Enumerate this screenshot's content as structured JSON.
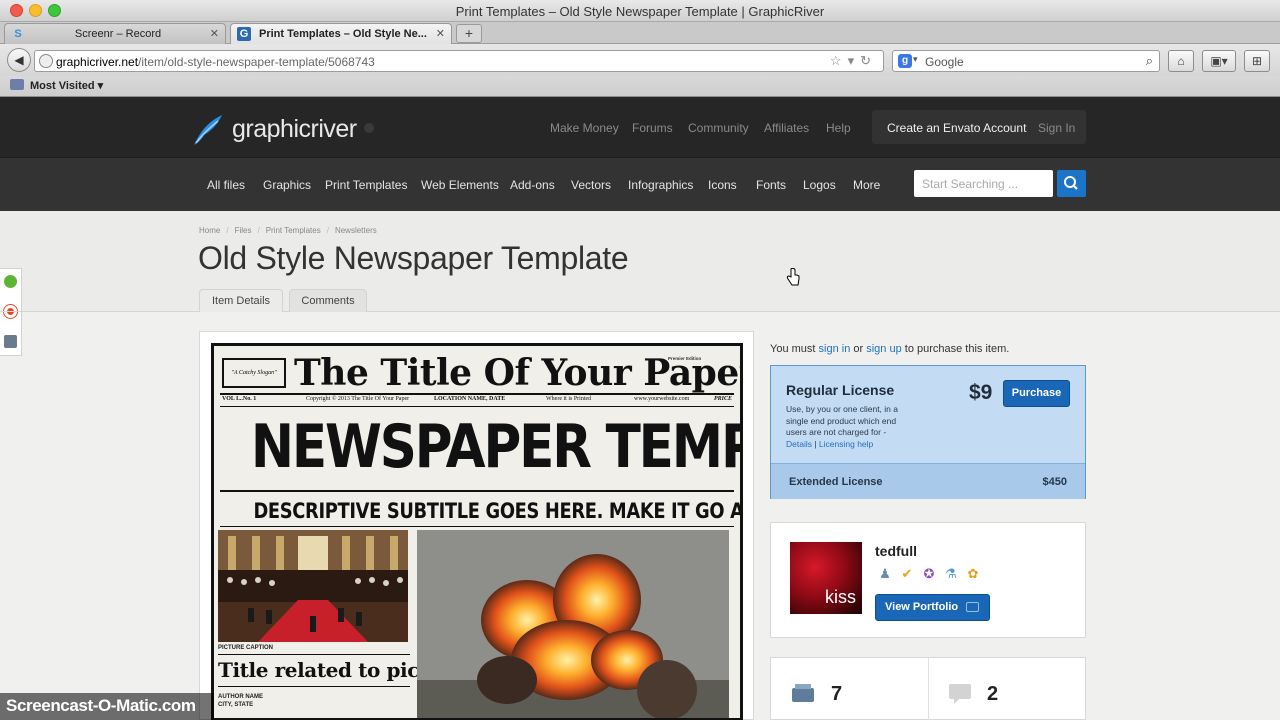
{
  "window": {
    "title": "Print Templates – Old Style Newspaper Template | GraphicRiver"
  },
  "tabs": [
    {
      "label": "Screenr – Record",
      "favicon": "S"
    },
    {
      "label": "Print Templates – Old Style Ne...",
      "favicon": "G"
    }
  ],
  "newtab_label": "+",
  "urlbar": {
    "host": "graphicriver.net",
    "path": "/item/old-style-newspaper-template/5068743"
  },
  "search": {
    "engine": "Google"
  },
  "bookmarks": {
    "most_visited": "Most Visited"
  },
  "header": {
    "logo": "graphicriver",
    "nav": [
      "Make Money",
      "Forums",
      "Community",
      "Affiliates",
      "Help"
    ],
    "create_account": "Create an Envato Account",
    "sign_in": "Sign In"
  },
  "categories": [
    "All files",
    "Graphics",
    "Print Templates",
    "Web Elements",
    "Add-ons",
    "Vectors",
    "Infographics",
    "Icons",
    "Fonts",
    "Logos",
    "More"
  ],
  "site_search": {
    "placeholder": "Start Searching ..."
  },
  "breadcrumb": [
    "Home",
    "Files",
    "Print Templates",
    "Newsletters"
  ],
  "page_title": "Old Style Newspaper Template",
  "page_tabs": [
    "Item Details",
    "Comments"
  ],
  "preview": {
    "slogan": "\"A Catchy Slogan\"",
    "masthead": "The Title Of Your Paper",
    "edition": "Premier Edition",
    "vol": "VOL I...No. 1",
    "copyright": "Copyright © 2013 The Title Of Your Paper",
    "location": "LOCATION NAME, DATE",
    "where": "Where it is Printed",
    "website": "www.yourwebsite.com",
    "price": "PRICE",
    "headline": "NEWSPAPER TEMPLATE",
    "subtitle": "DESCRIPTIVE SUBTITLE GOES HERE. MAKE IT GO ACROSS.",
    "caption": "PICTURE CAPTION",
    "title_pic": "Title related to pic",
    "author_name": "AUTHOR NAME",
    "author_city": "CITY, STATE"
  },
  "purchase": {
    "notice_prefix": "You must ",
    "sign_in": "sign in",
    "or": " or ",
    "sign_up": "sign up",
    "notice_suffix": " to purchase this item.",
    "regular_title": "Regular License",
    "regular_price": "$9",
    "purchase_button": "Purchase",
    "regular_desc": "Use, by you or one client, in a single end product which end users are not charged for -",
    "details_link": "Details",
    "sep": " | ",
    "licensing_link": "Licensing help",
    "extended_title": "Extended License",
    "extended_price": "$450"
  },
  "author": {
    "username": "tedfull",
    "avatar_text": "kiss",
    "view_portfolio": "View Portfolio",
    "badges": [
      "author-badge-icon",
      "check-badge-icon",
      "ribbon-badge-icon",
      "flask-badge-icon",
      "paw-badge-icon"
    ]
  },
  "stats": {
    "purchases": "7",
    "comments": "2"
  },
  "watermark": "Screencast-O-Matic.com"
}
